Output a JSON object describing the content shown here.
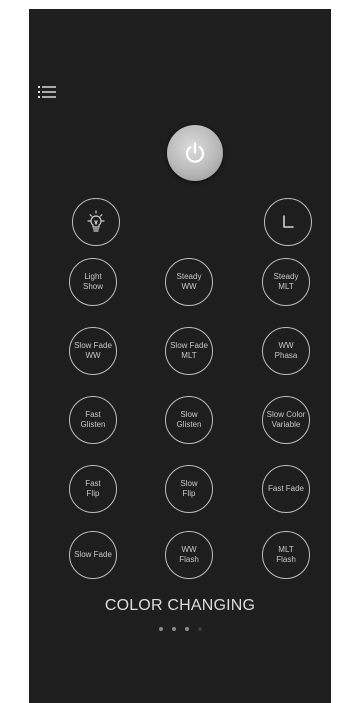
{
  "icons": {
    "menu": "hamburger-list-icon",
    "power": "power-icon",
    "bulb": "light-bulb-icon",
    "timer": "timer-corner-icon"
  },
  "modes": [
    {
      "label": "Light\nShow"
    },
    {
      "label": "Steady\nWW"
    },
    {
      "label": "Steady\nMLT"
    },
    {
      "label": "Slow Fade\nWW"
    },
    {
      "label": "Slow Fade\nMLT"
    },
    {
      "label": "WW\nPhasa"
    },
    {
      "label": "Fast\nGlisten"
    },
    {
      "label": "Slow\nGlisten"
    },
    {
      "label": "Slow Color\nVariable"
    },
    {
      "label": "Fast\nFlip"
    },
    {
      "label": "Slow\nFlip"
    },
    {
      "label": "Fast Fade"
    },
    {
      "label": "Slow Fade"
    },
    {
      "label": "WW\nFlash"
    },
    {
      "label": "MLT\nFlash"
    }
  ],
  "page_title": "COLOR CHANGING",
  "pager": {
    "current_page": 3,
    "total_pages": 4
  },
  "colors": {
    "background": "#1e1e1e",
    "circle_border": "#bdbdbd",
    "text": "#c8c8c8",
    "power_button": "#c4c4c4"
  }
}
